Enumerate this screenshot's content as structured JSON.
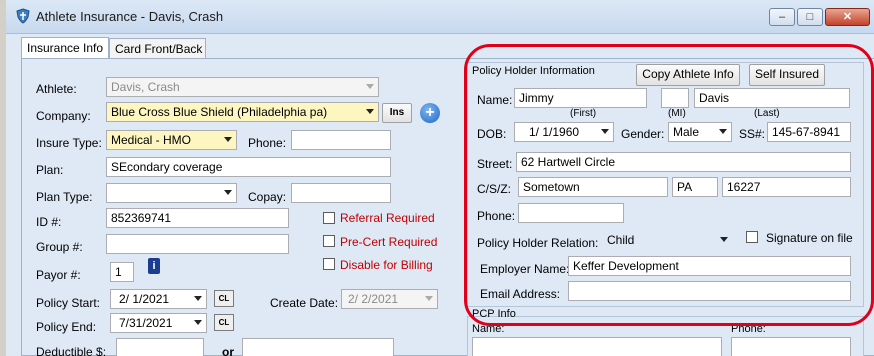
{
  "window": {
    "title": "Athlete Insurance - Davis, Crash",
    "minimize": "–",
    "maximize": "□",
    "close": "✕"
  },
  "tabs": [
    {
      "label": "Insurance Info"
    },
    {
      "label": "Card Front/Back"
    }
  ],
  "left": {
    "athlete_label": "Athlete:",
    "athlete_value": "Davis, Crash",
    "company_label": "Company:",
    "company_value": "Blue Cross Blue Shield (Philadelphia pa)",
    "ins_button": "Ins",
    "add_button": "+",
    "insure_type_label": "Insure Type:",
    "insure_type_value": "Medical - HMO",
    "phone_label": "Phone:",
    "phone_value": "",
    "plan_label": "Plan:",
    "plan_value": "SEcondary coverage",
    "plan_type_label": "Plan Type:",
    "plan_type_value": "",
    "copay_label": "Copay:",
    "copay_value": "",
    "id_label": "ID #:",
    "id_value": "852369741",
    "referral_label": "Referral Required",
    "group_label": "Group #:",
    "group_value": "",
    "precert_label": "Pre-Cert Required",
    "payor_label": "Payor #:",
    "payor_value": "1",
    "disable_billing_label": "Disable for Billing",
    "policy_start_label": "Policy Start:",
    "policy_start_value": "2/ 1/2021",
    "create_date_label": "Create Date:",
    "create_date_value": "2/ 2/2021",
    "policy_end_label": "Policy End:",
    "policy_end_value": "7/31/2021",
    "cl_label": "CL",
    "deductible_label": "Deductible $:",
    "deductible_value": "",
    "or_label": "or",
    "deductible_alt_value": ""
  },
  "policy_holder": {
    "group_title": "Policy Holder Information",
    "copy_button": "Copy Athlete Info",
    "self_button": "Self Insured",
    "name_label": "Name:",
    "first_value": "Jimmy",
    "mi_value": "",
    "last_value": "Davis",
    "first_caption": "(First)",
    "mi_caption": "(MI)",
    "last_caption": "(Last)",
    "dob_label": "DOB:",
    "dob_value": "1/ 1/1960",
    "gender_label": "Gender:",
    "gender_value": "Male",
    "ssn_label": "SS#:",
    "ssn_value": "145-67-8941",
    "street_label": "Street:",
    "street_value": "62 Hartwell Circle",
    "csz_label": "C/S/Z:",
    "city_value": "Sometown",
    "state_value": "PA",
    "zip_value": "16227",
    "phone_label": "Phone:",
    "phone_value": "",
    "relation_label": "Policy Holder Relation:",
    "relation_value": "Child",
    "signature_label": "Signature on file",
    "employer_label": "Employer Name:",
    "employer_value": "Keffer Development",
    "email_label": "Email Address:",
    "email_value": ""
  },
  "pcp": {
    "group_title": "PCP Info",
    "name_label": "Name:",
    "phone_label": "Phone:"
  }
}
